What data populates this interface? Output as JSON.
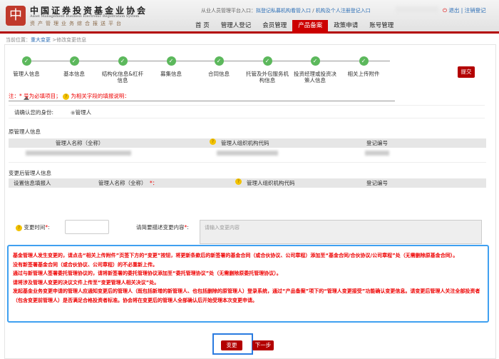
{
  "header": {
    "logo_mark": "中",
    "logo_cn": "中国证券投资基金业协会",
    "logo_en": "Asset Management Business Electronic Registration System",
    "logo_sub": "资产管理业务综合报送平台",
    "toplinks": {
      "prefix": "从业人员管理平台入口：",
      "link1": "拟登记私募机构看管入口",
      "sep": " / ",
      "link2": "机构及个人注册登记入口"
    },
    "logout_icon": "power-icon",
    "logout": "退出",
    "sep": " | ",
    "deregister": "注销登记",
    "nav": [
      "首 页",
      "管理人登记",
      "会员管理",
      "产品备案",
      "政策申请",
      "账号管理"
    ],
    "nav_active": 3
  },
  "breadcrumb": {
    "prefix": "当前位置：",
    "link": "重大变更",
    "current": " >修改变更信息"
  },
  "steps": [
    {
      "label": "管理人信息"
    },
    {
      "label": "基本信息"
    },
    {
      "label": "结构化信息&杠杆信息"
    },
    {
      "label": "募集信息"
    },
    {
      "label": "合同信息"
    },
    {
      "label": "托管及外包服务机构信息"
    },
    {
      "label": "投资经理或投资决策人信息"
    },
    {
      "label": "相关上传附件"
    }
  ],
  "step_check": "✓",
  "submit": "提交",
  "note": {
    "a": "注：* 号为必填项目；",
    "q": "?",
    "b": "为相关字段的填报说明："
  },
  "identity": {
    "label": "请确认您的身份:",
    "option": "管理人"
  },
  "original": {
    "title": "原管理人信息",
    "cols": [
      "管理人名称（全称）",
      "管理人组织机构代码",
      "登记编号"
    ]
  },
  "after": {
    "title": "变更后管理人信息",
    "cols": [
      "设置信息填报人",
      "管理人名称（全称）",
      "*：",
      "管理人组织机构代码",
      "登记编号"
    ]
  },
  "form": {
    "time_label": "变更时间",
    "req": "*",
    ":": ":",
    "desc_label": "请简要描述变更内容",
    "desc_placeholder": "请输入变更内容"
  },
  "notice": [
    "基金管理人发生变更的，请点击“相关上传附件”页签下方的“变更”按钮，将更新条款后的新签署的基金合同（或合伙协议、公司章程）添加至“基金合同/合伙协议/公司章程”处（无需删除原基金合同）。",
    "没有新签署基金合同（或合伙协议、公司章程）的不必重新上传。",
    "通过与新管理人签署委托管理协议的，请将新签署的委托管理协议添加至“委托管理协议”处（无需删除原委托管理协议）。",
    "请将涉及管理人变更的决议文件上传至“变更管理人相关决议”处。",
    "发起基金业务变更申请的管理人应通知变更后的管理人（既包括新增的新管理人、也包括删除的原管理人）登录系统，通过“产品备案”项下的“管理人变更接受”功能确认变更信息。请变更后管理人关注全部投资者（包含变更前管理人）是否满足合格投资者标准。协会将在变更后的管理人全部确认后开始受理本次变更申请。"
  ],
  "buttons": {
    "change": "变更",
    "next": "下一步"
  }
}
